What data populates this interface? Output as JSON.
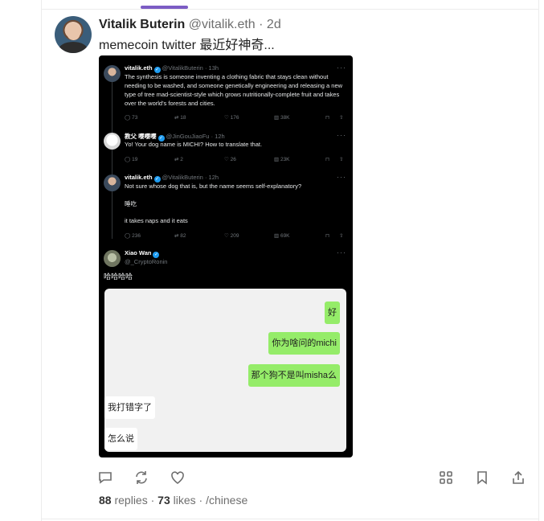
{
  "post": {
    "author_name": "Vitalik Buterin",
    "author_handle": "@vitalik.eth",
    "separator": "·",
    "time": "2d",
    "text": "memecoin twitter 最近好神奇..."
  },
  "embed": {
    "tweets": [
      {
        "name": "vitalik.eth",
        "handle": "@VitalikButerin",
        "time": "· 13h",
        "text": "The synthesis is someone inventing a clothing fabric that stays clean without needing to be washed, and someone genetically engineering and releasing a new type of tree mad-scientist-style which grows nutritionally-complete fruit and takes over the world's forests and cities.",
        "replies": "73",
        "reposts": "18",
        "likes": "176",
        "views": "38K"
      },
      {
        "name": "教父 嘤嘤嘤",
        "handle": "@JinGouJiaoFu",
        "time": "· 12h",
        "text": "Yo! Your dog name is MICHI? How to translate that.",
        "replies": "19",
        "reposts": "2",
        "likes": "26",
        "views": "23K"
      },
      {
        "name": "vitalik.eth",
        "handle": "@VitalikButerin",
        "time": "· 12h",
        "text": "Not sure whose dog that is, but the name seems self-explanatory?",
        "text2": "睡吃",
        "text3": "it takes naps and it eats",
        "replies": "236",
        "reposts": "82",
        "likes": "209",
        "views": "69K"
      },
      {
        "name": "Xiao Wan",
        "handle": "@_CryptoRonin",
        "text": "哈哈哈哈"
      }
    ],
    "chat": [
      {
        "side": "right",
        "text": "好"
      },
      {
        "side": "right",
        "text": "你为啥问的michi"
      },
      {
        "side": "right",
        "text": "那个狗不是叫misha么"
      },
      {
        "side": "left",
        "text": "我打错字了"
      },
      {
        "side": "left",
        "text": "怎么说"
      }
    ],
    "more_glyph": "···"
  },
  "stats": {
    "replies_count": "88",
    "replies_label": "replies",
    "likes_count": "73",
    "likes_label": "likes",
    "sep": "·",
    "tag": "/chinese"
  },
  "icons": [
    "reply-icon",
    "recast-icon",
    "like-icon",
    "grid-icon",
    "bookmark-icon",
    "share-icon"
  ],
  "colors": {
    "accent": "#7c5cc4",
    "verified": "#1d9bf0",
    "wechat_green": "#95ec69"
  }
}
